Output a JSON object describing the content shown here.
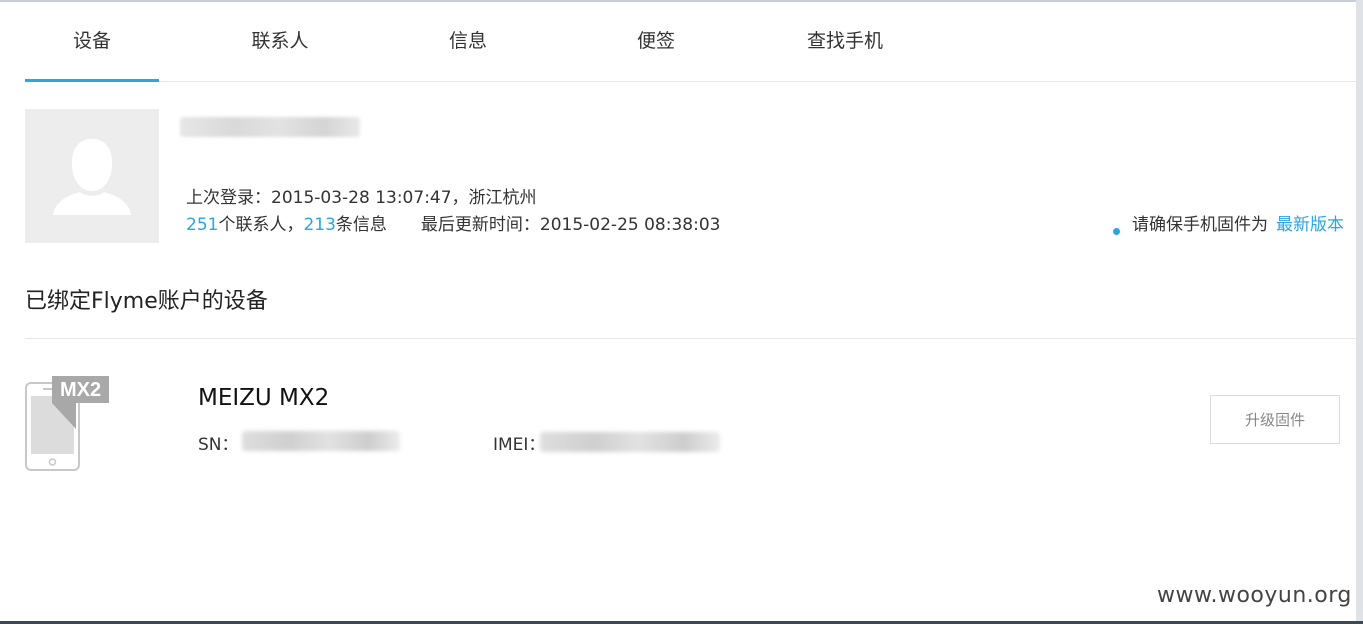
{
  "tabs": [
    {
      "label": "设备",
      "active": true
    },
    {
      "label": "联系人"
    },
    {
      "label": "信息"
    },
    {
      "label": "便签"
    },
    {
      "label": "查找手机"
    }
  ],
  "profile": {
    "last_login_label": "上次登录：",
    "last_login_value": "2015-03-28 13:07:47，浙江杭州",
    "contacts_count": "251",
    "contacts_suffix": "个联系人，",
    "messages_count": "213",
    "messages_suffix": "条信息",
    "last_update_label": "最后更新时间：",
    "last_update_value": "2015-02-25 08:38:03"
  },
  "notice": {
    "text": "请确保手机固件为",
    "link": "最新版本"
  },
  "section": {
    "title": "已绑定Flyme账户的设备"
  },
  "device": {
    "badge": "MX2",
    "name": "MEIZU MX2",
    "sn_label": "SN：",
    "imei_label": "IMEI：",
    "upgrade_label": "升级固件"
  },
  "watermark": "www.wooyun.org",
  "colors": {
    "accent": "#2aa6e0",
    "divider": "#e6e6e6",
    "avatar_bg": "#ededed"
  }
}
